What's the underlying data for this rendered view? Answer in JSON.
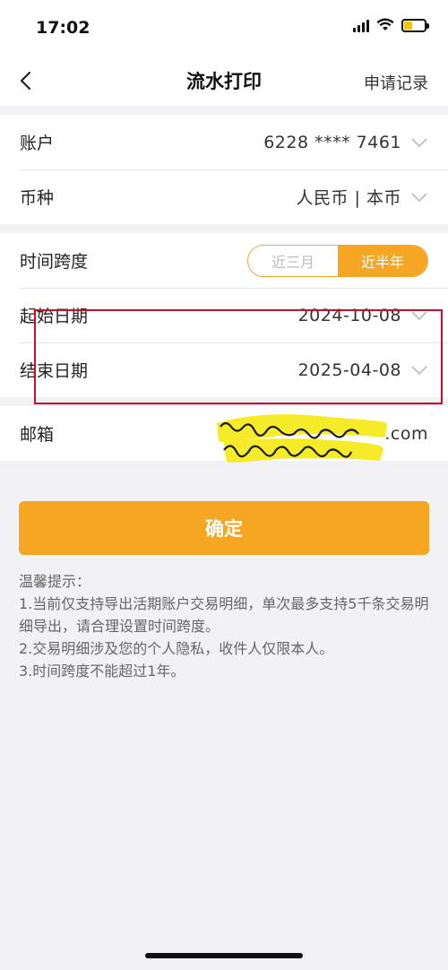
{
  "status_bar": {
    "time": "17:02",
    "battery_level": 0.4
  },
  "nav": {
    "title": "流水打印",
    "right_action": "申请记录"
  },
  "form": {
    "account": {
      "label": "账户",
      "value": "6228 **** 7461"
    },
    "currency": {
      "label": "币种",
      "value": "人民币 | 本币"
    },
    "time_span": {
      "label": "时间跨度",
      "options": [
        "近三月",
        "近半年"
      ],
      "selected": "近半年"
    },
    "start_date": {
      "label": "起始日期",
      "value": "2024-10-08"
    },
    "end_date": {
      "label": "结束日期",
      "value": "2025-04-08"
    },
    "email": {
      "label": "邮箱",
      "value_suffix": ".com"
    }
  },
  "confirm_label": "确定",
  "tips": {
    "title": "温馨提示：",
    "lines": [
      "1.当前仅支持导出活期账户交易明细，单次最多支持5千条交易明细导出，请合理设置时间跨度。",
      "2.交易明细涉及您的个人隐私，收件人仅限本人。",
      "3.时间跨度不能超过1年。"
    ]
  },
  "colors": {
    "accent": "#f5a623",
    "highlight_box": "#c8102e",
    "background": "#f2f2f4"
  }
}
